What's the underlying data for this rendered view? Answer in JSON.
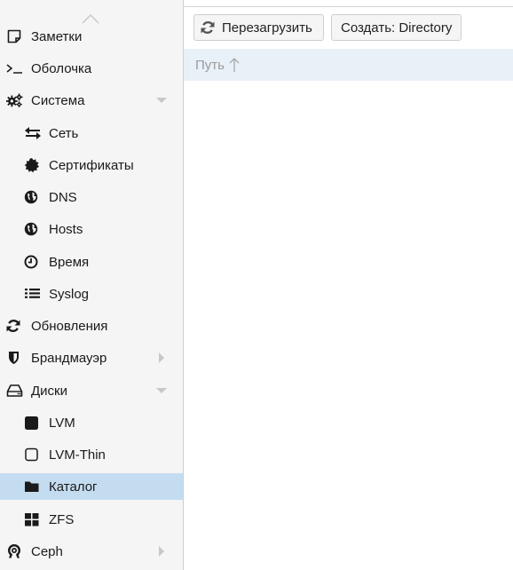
{
  "sidebar": {
    "items": [
      {
        "label": "Заметки",
        "icon": "notes-icon"
      },
      {
        "label": "Оболочка",
        "icon": "terminal-icon"
      },
      {
        "label": "Система",
        "icon": "gears-icon",
        "expanded": true
      },
      {
        "label": "Сеть",
        "icon": "exchange-icon"
      },
      {
        "label": "Сертификаты",
        "icon": "certificate-icon"
      },
      {
        "label": "DNS",
        "icon": "globe-icon"
      },
      {
        "label": "Hosts",
        "icon": "globe-icon"
      },
      {
        "label": "Время",
        "icon": "clock-icon"
      },
      {
        "label": "Syslog",
        "icon": "list-icon"
      },
      {
        "label": "Обновления",
        "icon": "refresh-icon"
      },
      {
        "label": "Брандмауэр",
        "icon": "shield-icon",
        "expanded": false
      },
      {
        "label": "Диски",
        "icon": "hdd-icon",
        "expanded": true
      },
      {
        "label": "LVM",
        "icon": "square-filled-icon"
      },
      {
        "label": "LVM-Thin",
        "icon": "square-outline-icon"
      },
      {
        "label": "Каталог",
        "icon": "folder-icon",
        "selected": true
      },
      {
        "label": "ZFS",
        "icon": "th-large-icon"
      },
      {
        "label": "Ceph",
        "icon": "ceph-icon",
        "expanded": false
      }
    ]
  },
  "toolbar": {
    "reload_label": "Перезагрузить",
    "create_label": "Создать: Directory"
  },
  "grid": {
    "columns": [
      {
        "label": "Путь",
        "sort": "ascending"
      }
    ],
    "rows": []
  },
  "colors": {
    "sidebar_bg": "#f5f5f5",
    "selected_bg": "#c4dcf0",
    "header_bg": "#e9f1f8",
    "header_text": "#9a9a9a"
  }
}
